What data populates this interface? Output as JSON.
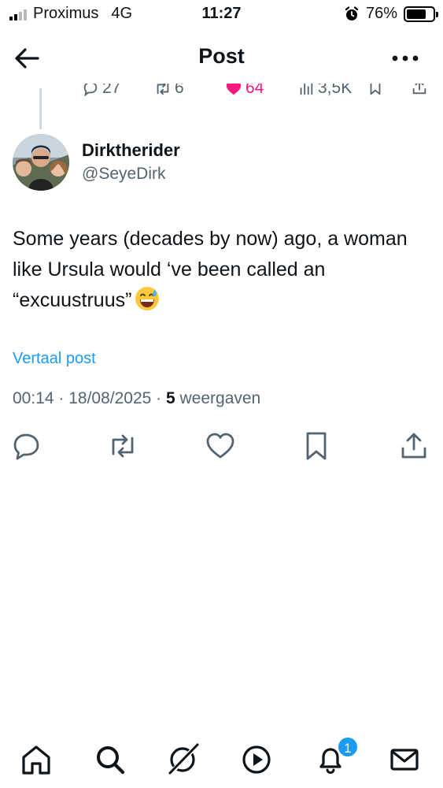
{
  "status_bar": {
    "carrier": "Proximus",
    "network": "4G",
    "time": "11:27",
    "battery": "76%",
    "battery_level": 0.76
  },
  "header": {
    "title": "Post",
    "back_icon": "arrow-left-icon",
    "more_icon": "more-dots-icon"
  },
  "parent_actions": {
    "replies": "27",
    "reposts": "6",
    "likes": "64",
    "views": "3,5K"
  },
  "author": {
    "name": "Dirktherider",
    "handle": "@SeyeDirk"
  },
  "tweet": {
    "text": "Some years (decades by now) ago, a woman like Ursula would ‘ve been called an “excuustruus”",
    "emoji": "grinning-face-with-sweat"
  },
  "translate_label": "Vertaal post",
  "meta": {
    "time_date": "00:14 · 18/08/2025 · ",
    "views_count": "5",
    "views_label": " weergaven"
  },
  "colors": {
    "accent": "#1d9bf0",
    "like": "#f91880",
    "secondary_text": "#536471",
    "text": "#0f1419"
  },
  "bottom_nav": {
    "notifications_badge": "1"
  }
}
